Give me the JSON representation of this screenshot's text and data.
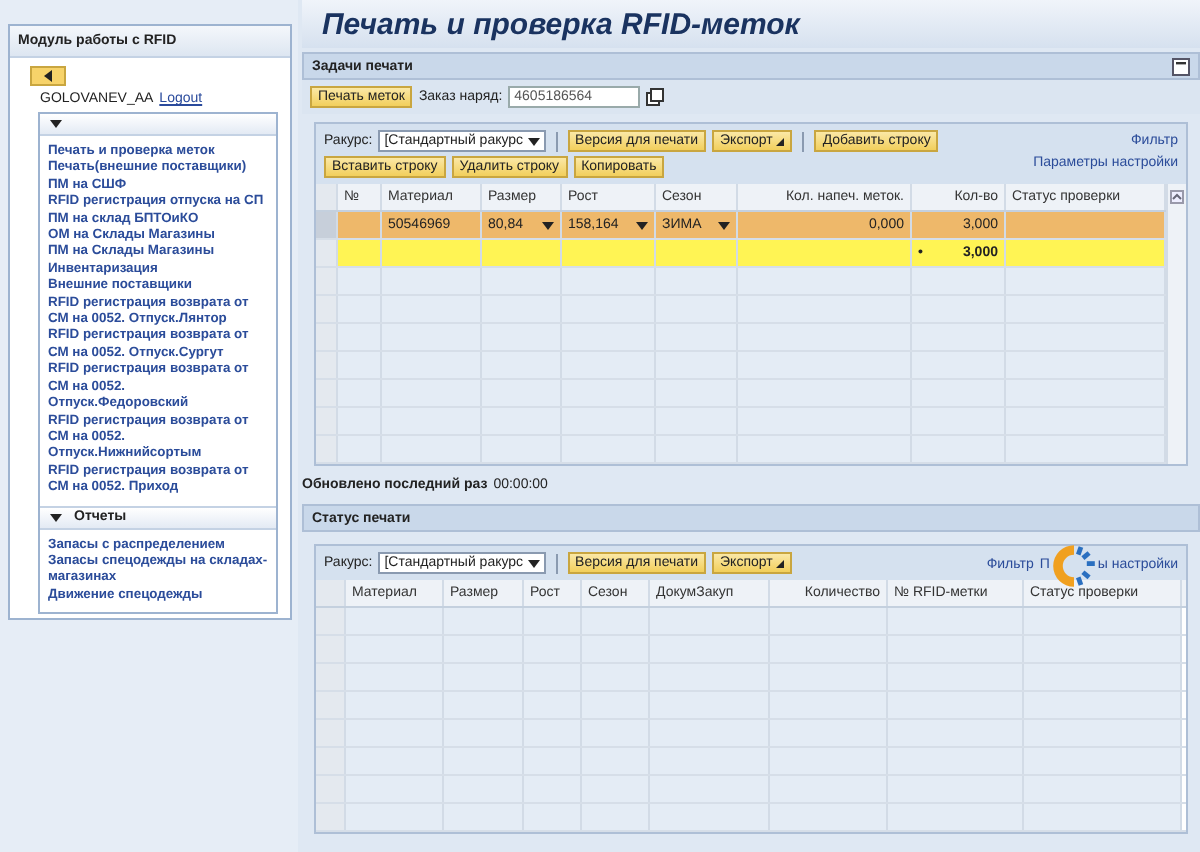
{
  "page_title": "Печать и проверка RFID-меток",
  "sidebar": {
    "title": "Модуль работы с RFID",
    "user": "GOLOVANEV_AA",
    "logout": "Logout",
    "menu_items": [
      "Печать и проверка меток",
      "Печать(внешние поставщики)",
      "ПМ на СШФ",
      "RFID регистрация отпуска на СП",
      "ПМ на склад БПТОиКО",
      "ОМ на Склады Магазины",
      "ПМ на Склады Магазины",
      "Инвентаризация",
      "Внешние поставщики",
      "RFID регистрация возврата от СМ на 0052. Отпуск.Лянтор",
      "RFID регистрация возврата от СМ на 0052. Отпуск.Сургут",
      "RFID регистрация возврата от СМ на 0052. Отпуск.Федоровский",
      "RFID регистрация возврата от СМ на 0052. Отпуск.Нижнийсортым",
      "RFID регистрация возврата от СМ на 0052. Приход"
    ],
    "reports": {
      "title": "Отчеты",
      "items": [
        "Запасы с распределением",
        "Запасы спецодежды на складах-магазинах",
        "Движение спецодежды"
      ]
    }
  },
  "print_tasks": {
    "title": "Задачи печати",
    "print_button": "Печать меток",
    "order_label": "Заказ наряд:",
    "order_value": "4605186564",
    "view_label": "Ракурс:",
    "view_value": "[Стандартный ракурс",
    "buttons_row1": [
      "Версия для печати",
      "Экспорт",
      "Добавить строку"
    ],
    "buttons_row2": [
      "Вставить строку",
      "Удалить строку",
      "Копировать"
    ],
    "links": [
      "Фильтр",
      "Параметры настройки"
    ],
    "columns": [
      "№",
      "Материал",
      "Размер",
      "Рост",
      "Сезон",
      "Кол. напеч. меток.",
      "Кол-во",
      "Статус проверки"
    ],
    "rows": [
      {
        "kind": "item",
        "selected": true,
        "cells": [
          "",
          "50546969",
          "80,84",
          "158,164",
          "ЗИМА",
          "0,000",
          "3,000",
          ""
        ]
      },
      {
        "kind": "total",
        "selected": false,
        "cells": [
          "",
          "",
          "",
          "",
          "",
          "",
          "3,000",
          ""
        ],
        "marker": "•"
      }
    ]
  },
  "updated": {
    "label": "Обновлено последний раз",
    "time": "00:00:00"
  },
  "print_status": {
    "title": "Статус печати",
    "view_label": "Ракурс:",
    "view_value": "[Стандартный ракурс",
    "buttons": [
      "Версия для печати",
      "Экспорт"
    ],
    "links": [
      "Фильтр",
      "П",
      "ы настройки"
    ],
    "columns": [
      "Материал",
      "Размер",
      "Рост",
      "Сезон",
      "ДокумЗакуп",
      "Количество",
      "№ RFID-метки",
      "Статус проверки"
    ]
  }
}
